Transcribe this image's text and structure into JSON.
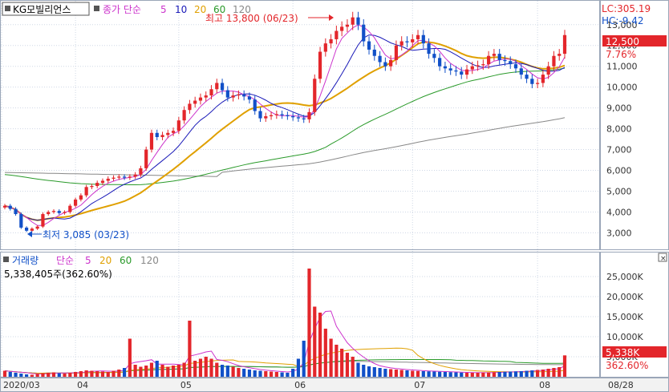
{
  "window": {
    "stock_name": "KG모빌리언스",
    "price_legend": {
      "label": "종가 단순",
      "periods": [
        "5",
        "10",
        "20",
        "60",
        "120"
      ]
    },
    "volume_legend": {
      "label_main": "거래량",
      "label_ma": "단순",
      "periods": [
        "5",
        "20",
        "60",
        "120"
      ]
    },
    "volume_info": "5,338,405주(362.60%)",
    "lc": "LC:305.19",
    "hc": "HC:-9.42",
    "current_price": "12,500",
    "change_pct": "7.76%",
    "current_volume": "5,338K",
    "volume_pct": "362.60%",
    "high_annotation": "최고 13,800 (06/23)",
    "low_annotation": "최저 3,085 (03/23)",
    "end_date": "08/28"
  },
  "colors": {
    "up": "#e3262b",
    "down": "#1150c8",
    "ma5": "#cc33cc",
    "ma10": "#1a1ab8",
    "ma20": "#e0a000",
    "ma60": "#2a9a2a",
    "ma120": "#888888",
    "grid": "#cfd8e6"
  },
  "chart_data": {
    "type": "candlestick",
    "price_axis": {
      "ticks": [
        "13,000",
        "12,000",
        "11,000",
        "10,000",
        "9,000",
        "8,000",
        "7,000",
        "6,000",
        "5,000",
        "4,000",
        "3,000"
      ],
      "range": [
        2400,
        13800
      ]
    },
    "volume_axis": {
      "ticks": [
        "25,000K",
        "20,000K",
        "15,000K",
        "10,000K",
        "5,000K"
      ],
      "range": [
        0,
        28000000
      ]
    },
    "x_ticks": [
      "2020/03",
      "04",
      "05",
      "06",
      "07",
      "08"
    ],
    "high": {
      "value": 13800,
      "date": "06/23"
    },
    "low": {
      "value": 3085,
      "date": "03/23"
    },
    "close_series": [
      4300,
      4150,
      3900,
      3250,
      3100,
      3200,
      3300,
      3900,
      4000,
      4050,
      3950,
      4000,
      4300,
      4600,
      4800,
      5200,
      5250,
      5400,
      5500,
      5600,
      5650,
      5700,
      5650,
      5700,
      5800,
      6100,
      7000,
      7800,
      7600,
      7700,
      7800,
      7900,
      8400,
      8900,
      9200,
      9350,
      9500,
      9600,
      9900,
      10200,
      9850,
      9500,
      9600,
      9650,
      9550,
      9400,
      8850,
      8500,
      8600,
      8650,
      8700,
      8650,
      8600,
      8550,
      8500,
      8450,
      8800,
      10400,
      11700,
      12100,
      12300,
      12700,
      12900,
      13000,
      13350,
      13000,
      12200,
      11800,
      11500,
      11200,
      11000,
      11300,
      12000,
      12200,
      12150,
      12300,
      12500,
      12100,
      11600,
      11400,
      11000,
      10900,
      10800,
      10750,
      10600,
      10850,
      11000,
      11050,
      11100,
      11500,
      11600,
      11300,
      11250,
      11100,
      10900,
      10600,
      10400,
      10150,
      10200,
      10600,
      11000,
      11500,
      11600,
      12500
    ],
    "volume_series_k": [
      1500,
      1200,
      1000,
      800,
      600,
      500,
      700,
      900,
      1000,
      1100,
      900,
      800,
      1000,
      1200,
      1400,
      1600,
      1500,
      1400,
      1300,
      1200,
      1500,
      1800,
      2200,
      9500,
      3000,
      2500,
      2800,
      3500,
      4000,
      3000,
      2500,
      2800,
      3000,
      3500,
      14000,
      4000,
      4500,
      5000,
      4500,
      3500,
      3000,
      2800,
      2500,
      2200,
      2000,
      1800,
      1600,
      1500,
      1400,
      1300,
      1200,
      1100,
      1000,
      2000,
      4500,
      9000,
      27000,
      17500,
      16000,
      12000,
      9500,
      8000,
      7000,
      6000,
      5000,
      3500,
      3000,
      2600,
      2400,
      2200,
      2000,
      1900,
      1800,
      1700,
      1600,
      1500,
      1450,
      1400,
      1350,
      1300,
      1250,
      1200,
      1150,
      1100,
      1050,
      1000,
      1000,
      1000,
      1050,
      1100,
      1150,
      1200,
      1250,
      1300,
      1350,
      1400,
      1500,
      1600,
      1700,
      1800,
      2000,
      2200,
      2400,
      5338
    ]
  }
}
